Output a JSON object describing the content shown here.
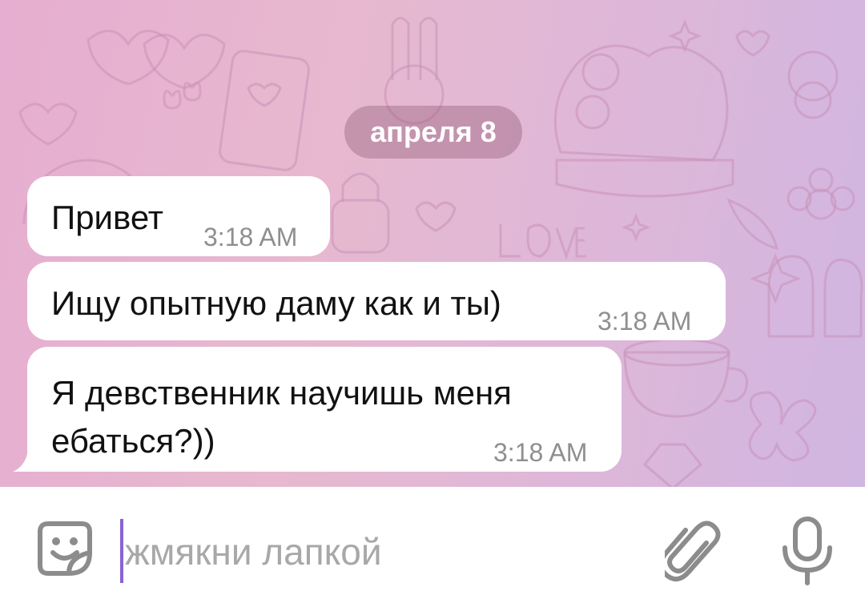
{
  "chat": {
    "date_separator": "апреля 8",
    "messages": [
      {
        "lines": [
          "Привет"
        ],
        "time": "3:18 AM"
      },
      {
        "lines": [
          "Ищу опытную даму как и ты)"
        ],
        "time": "3:18 AM"
      },
      {
        "lines": [
          "Я девственник научишь меня",
          "ебаться?))"
        ],
        "time": "3:18 AM"
      }
    ],
    "background_pattern_text": "LOVE"
  },
  "composer": {
    "placeholder": "жмякни лапкой",
    "value": ""
  },
  "icons": {
    "sticker": "sticker-smile-icon",
    "attach": "paperclip-icon",
    "mic": "microphone-icon"
  },
  "colors": {
    "bubble": "#ffffff",
    "time": "#8f8f8f",
    "caret": "#8a63d2",
    "icons": "#8c8c8c"
  }
}
